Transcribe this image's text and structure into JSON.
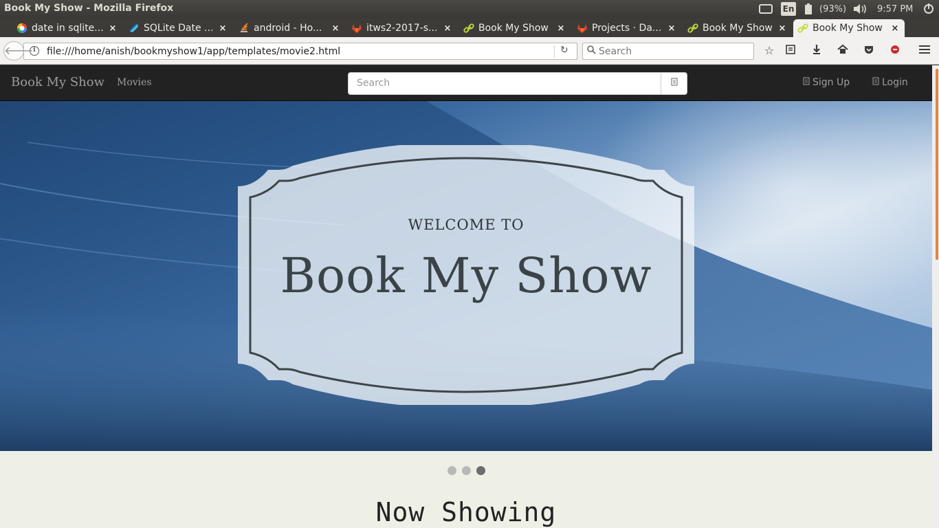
{
  "window": {
    "title": "Book My Show - Mozilla Firefox"
  },
  "tray": {
    "keyboard": "En",
    "battery": "(93%)",
    "clock": "9:57 PM"
  },
  "tabs": [
    {
      "label": "date in sqlite...",
      "icon": "google-icon"
    },
    {
      "label": "SQLite Date ...",
      "icon": "sqlite-icon"
    },
    {
      "label": "android - Ho...",
      "icon": "stackoverflow-icon"
    },
    {
      "label": "itws2-2017-s...",
      "icon": "gitlab-icon"
    },
    {
      "label": "Book My Show",
      "icon": "link-icon"
    },
    {
      "label": "Projects · Da...",
      "icon": "gitlab-icon"
    },
    {
      "label": "Book My Show",
      "icon": "link-icon"
    },
    {
      "label": "Book My Show",
      "icon": "link-icon",
      "active": true
    }
  ],
  "navbar": {
    "url": "file:///home/anish/bookmyshow1/app/templates/movie2.html",
    "search_placeholder": "Search"
  },
  "site": {
    "brand": "Book My Show",
    "movies_link": "Movies",
    "search_placeholder": "Search",
    "signup": "Sign Up",
    "login": "Login"
  },
  "hero": {
    "welcome": "WELCOME TO",
    "title": "Book My Show"
  },
  "carousel": {
    "slides": 3,
    "active_index": 2
  },
  "section": {
    "heading": "Now Showing"
  },
  "colors": {
    "site_nav": "#222222",
    "accent_scroll": "#e4843f",
    "badge_border": "#3e4548"
  }
}
